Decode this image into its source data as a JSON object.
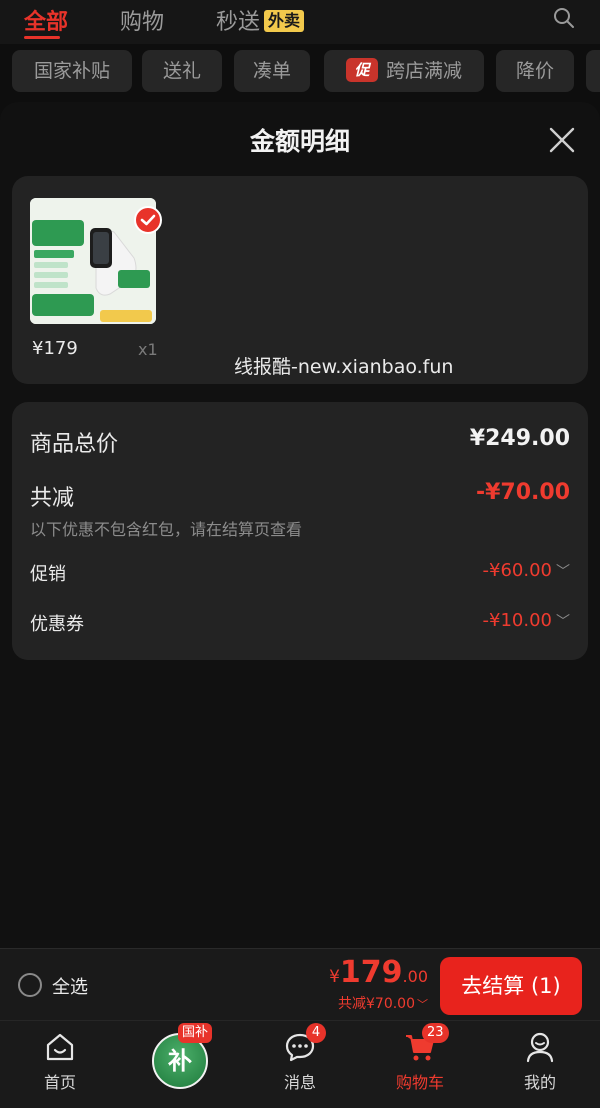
{
  "top_tabs": {
    "all": "全部",
    "shopping": "购物",
    "express": "秒送",
    "express_badge": "外卖"
  },
  "chips": [
    "国家补贴",
    "送礼",
    "凑单",
    "跨店满减",
    "降价"
  ],
  "chips_promo_tag": "促",
  "sheet": {
    "title": "金额明细",
    "product": {
      "price": "¥179",
      "qty": "x1",
      "image_alt": "华为手环 10 标准版"
    },
    "watermark": "线报酷-new.xianbao.fun",
    "details": {
      "total_label": "商品总价",
      "total_value": "¥249.00",
      "discount_label": "共减",
      "discount_value": "-¥70.00",
      "note": "以下优惠不包含红包，请在结算页查看",
      "promo_label": "促销",
      "promo_value": "-¥60.00",
      "coupon_label": "优惠券",
      "coupon_value": "-¥10.00"
    }
  },
  "checkout": {
    "select_all": "全选",
    "yen": "¥",
    "amount_int": "179",
    "amount_dec": ".00",
    "saved": "共减¥70.00",
    "pay_button": "去结算 (1)"
  },
  "nav": {
    "home": "首页",
    "subsidy_char": "补",
    "subsidy_tag": "国补",
    "messages": "消息",
    "messages_badge": "4",
    "cart": "购物车",
    "cart_badge": "23",
    "me": "我的"
  },
  "colors": {
    "accent": "#e8332a",
    "price_red": "#ef3b2f",
    "card_bg": "#232323",
    "badge_yellow": "#f2c94c",
    "subsidy_green": "#2e8b4a"
  }
}
